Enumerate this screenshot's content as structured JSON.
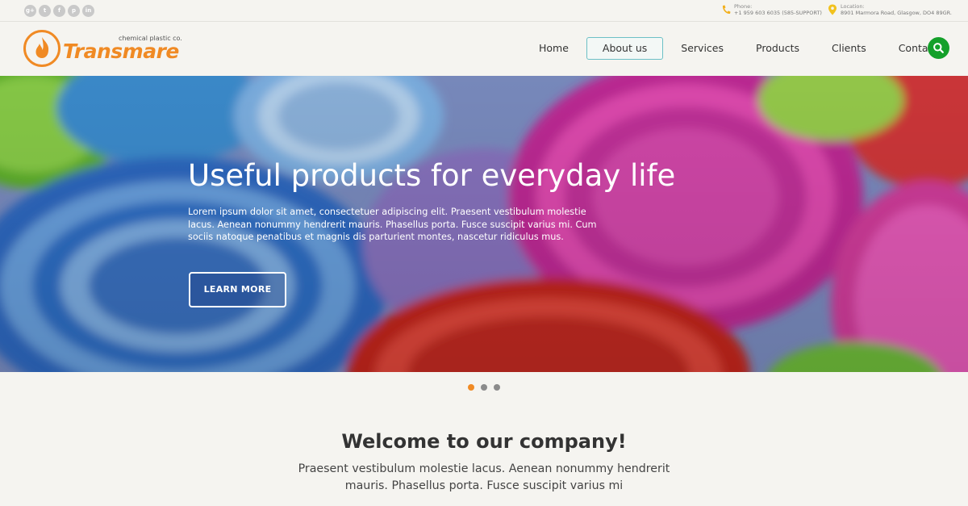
{
  "topbar": {
    "socials": [
      {
        "icon": "google-plus-icon",
        "glyph": "g+"
      },
      {
        "icon": "twitter-icon",
        "glyph": "t"
      },
      {
        "icon": "facebook-icon",
        "glyph": "f"
      },
      {
        "icon": "pinterest-icon",
        "glyph": "p"
      },
      {
        "icon": "linkedin-icon",
        "glyph": "in"
      }
    ],
    "phone": {
      "label": "Phone:",
      "value": "+1 959 603 6035 (585-SUPPORT)"
    },
    "location": {
      "label": "Location:",
      "value": "8901 Marmora Road, Glasgow, DO4 89GR."
    }
  },
  "header": {
    "logo_name": "Transmare",
    "logo_tag": "chemical plastic co.",
    "nav": [
      "Home",
      "About us",
      "Services",
      "Products",
      "Clients",
      "Contacts"
    ],
    "active_nav": "About us"
  },
  "hero": {
    "title": "Useful products for everyday life",
    "text": "Lorem ipsum dolor sit amet, consectetuer adipiscing elit. Praesent vestibulum molestie lacus. Aenean nonummy hendrerit mauris. Phasellus porta. Fusce suscipit varius mi. Cum sociis natoque penatibus et magnis dis parturient montes, nascetur ridiculus mus.",
    "button": "LEARN MORE"
  },
  "slider": {
    "count": 3,
    "active": 1
  },
  "welcome": {
    "title": "Welcome to our company!",
    "text": "Praesent vestibulum molestie lacus. Aenean nonummy hendrerit mauris. Phasellus porta. Fusce suscipit varius mi"
  },
  "colors": {
    "accent": "#f08a24",
    "search": "#14a02a",
    "nav_active_border": "#6cc0c6"
  }
}
